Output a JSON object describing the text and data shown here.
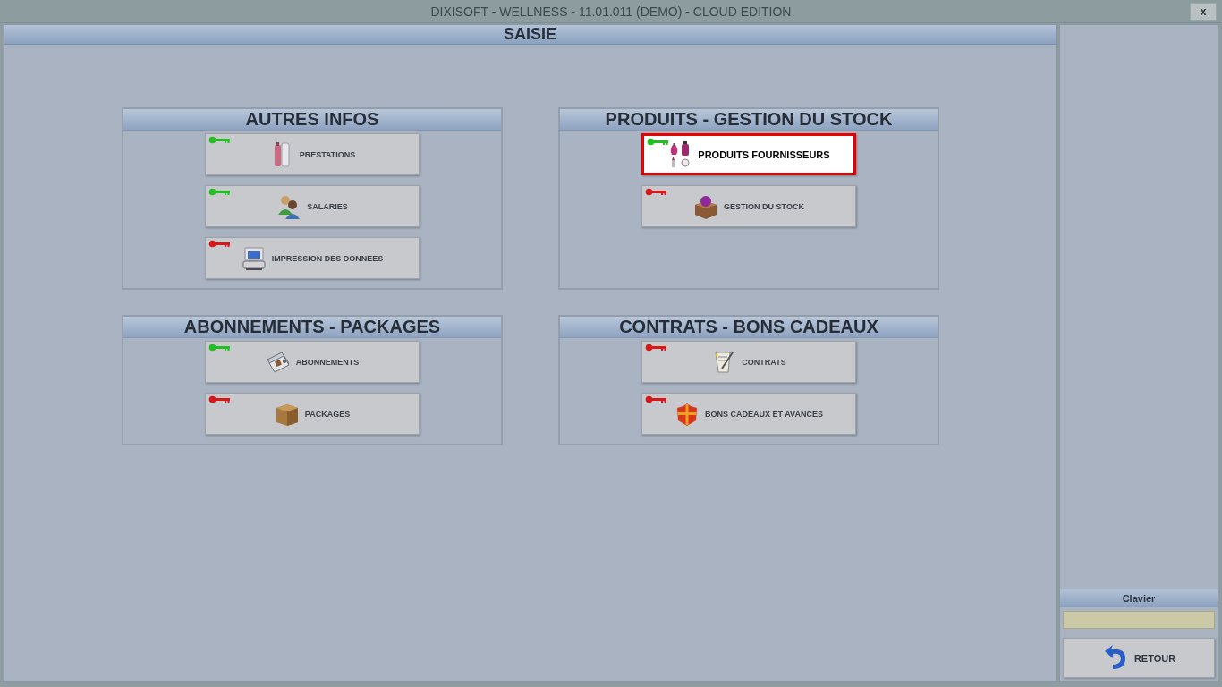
{
  "window": {
    "title": "DIXISOFT - WELLNESS - 11.01.011 (DEMO) - CLOUD EDITION",
    "close": "x"
  },
  "main": {
    "title": "SAISIE",
    "groups": [
      {
        "title": "AUTRES INFOS",
        "buttons": [
          {
            "label": "PRESTATIONS",
            "color": "#22c01e",
            "selected": false
          },
          {
            "label": "SALARIES",
            "color": "#22c01e",
            "selected": false
          },
          {
            "label": "IMPRESSION DES DONNEES",
            "color": "#d81818",
            "selected": false
          }
        ]
      },
      {
        "title": "PRODUITS - GESTION DU STOCK",
        "buttons": [
          {
            "label": "PRODUITS FOURNISSEURS",
            "color": "#22c01e",
            "selected": true
          },
          {
            "label": "GESTION DU STOCK",
            "color": "#d81818",
            "selected": false
          }
        ]
      },
      {
        "title": "ABONNEMENTS - PACKAGES",
        "buttons": [
          {
            "label": "ABONNEMENTS",
            "color": "#22c01e",
            "selected": false
          },
          {
            "label": "PACKAGES",
            "color": "#d81818",
            "selected": false
          }
        ]
      },
      {
        "title": "CONTRATS - BONS CADEAUX",
        "buttons": [
          {
            "label": "CONTRATS",
            "color": "#d81818",
            "selected": false
          },
          {
            "label": "BONS CADEAUX ET AVANCES",
            "color": "#d81818",
            "selected": false
          }
        ]
      }
    ]
  },
  "sidebar": {
    "keyboard_title": "Clavier",
    "back_button": "RETOUR"
  }
}
